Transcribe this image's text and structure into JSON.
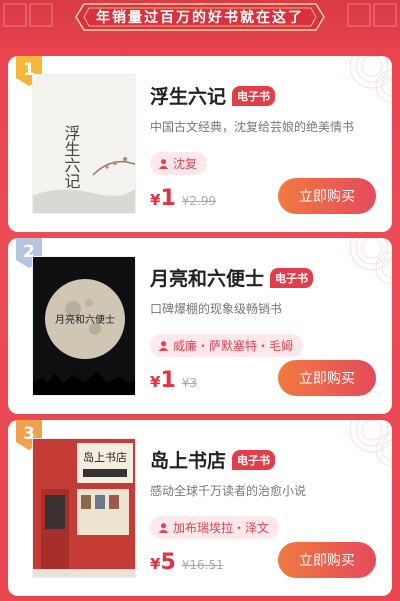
{
  "banner": {
    "title": "年销量过百万的好书就在这了"
  },
  "colors": {
    "accent": "#e2323e",
    "background": "#e8434d",
    "button_start": "#f07a40",
    "button_end": "#e64a5b"
  },
  "books": [
    {
      "rank": "1",
      "title": "浮生六记",
      "tag": "电子书",
      "desc": "中国古文经典，沈复给芸娘的绝美情书",
      "author": "沈复",
      "currency": "¥",
      "price": "1",
      "original_price": "¥2.99",
      "buy_label": "立即购买"
    },
    {
      "rank": "2",
      "title": "月亮和六便士",
      "tag": "电子书",
      "desc": "口碑爆棚的现象级畅销书",
      "author": "威廉・萨默塞特・毛姆",
      "currency": "¥",
      "price": "1",
      "original_price": "¥3",
      "buy_label": "立即购买"
    },
    {
      "rank": "3",
      "title": "岛上书店",
      "tag": "电子书",
      "desc": "感动全球千万读者的治愈小说",
      "author": "加布瑞埃拉・泽文",
      "currency": "¥",
      "price": "5",
      "original_price": "¥16.51",
      "buy_label": "立即购买"
    }
  ],
  "covers": {
    "book1_title": "浮生六记",
    "book2_title": "月亮和六便士",
    "book3_title": "岛上书店"
  }
}
